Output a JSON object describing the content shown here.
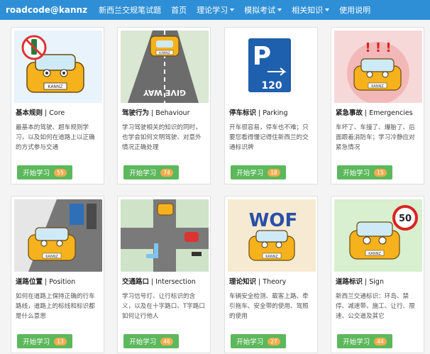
{
  "navbar": {
    "brand": "roadcode@kannz",
    "items": [
      "新西兰交规笔试题",
      "首页",
      "理论学习",
      "模拟考试",
      "相关知识",
      "使用说明"
    ]
  },
  "cards": [
    {
      "title": "基本规则",
      "subtitle": "Core",
      "desc": "最基本的驾驶、超车规则学习，以及如何在道路上以正确的方式参与交通",
      "button": "开始学习",
      "count": "55"
    },
    {
      "title": "驾驶行为",
      "subtitle": "Behaviour",
      "desc": "学习驾驶相关的知识的同时，也学会如何文明驾驶、对意外情况正确处理",
      "button": "开始学习",
      "count": "74"
    },
    {
      "title": "停车标识",
      "subtitle": "Parking",
      "desc": "开车很容易，停车也不难；只要您看得懂记得住新西兰的交通标识牌",
      "button": "开始学习",
      "count": "18"
    },
    {
      "title": "紧急事故",
      "subtitle": "Emergencies",
      "desc": "车坏了、车撞了、爆胎了、后面跟着消防车；学习冷静应对紧急情况",
      "button": "开始学习",
      "count": "15"
    },
    {
      "title": "道路位置",
      "subtitle": "Position",
      "desc": "如何在道路上保持正确的行车路线，道路上的标线和标识都是什么意思",
      "button": "开始学习",
      "count": "13"
    },
    {
      "title": "交通路口",
      "subtitle": "Intersection",
      "desc": "学习信号灯、让行标识的含义，以及在十字路口、T字路口如何让行他人",
      "button": "开始学习",
      "count": "46"
    },
    {
      "title": "理论知识",
      "subtitle": "Theory",
      "desc": "车辆安全检测、载客上路、牵引拖车、安全带的使用、驾照的使用",
      "button": "开始学习",
      "count": "27"
    },
    {
      "title": "道路标识",
      "subtitle": "Sign",
      "desc": "新西兰交通标识：环岛、禁停、减速带、施工、让行、限速、公交道及其它",
      "button": "开始学习",
      "count": "44"
    }
  ],
  "art": {
    "plate": "KANNZ",
    "give_way": "GIVE WAY",
    "parking_letter": "P",
    "parking_time": "120",
    "exclaim": "! ! !",
    "woof": "WOF",
    "speed": "50"
  }
}
